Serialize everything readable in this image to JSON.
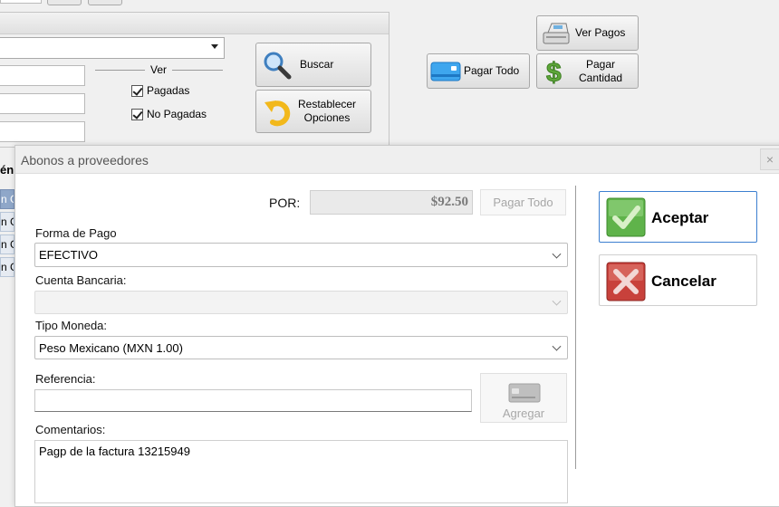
{
  "background": {
    "ver_group_label": "Ver",
    "chk_pagadas": "Pagadas",
    "chk_no_pagadas": "No Pagadas",
    "buscar": "Buscar",
    "restablecer_line1": "Restablecer",
    "restablecer_line2": "Opciones",
    "pagar_todo": "Pagar Todo",
    "ver_pagos": "Ver Pagos",
    "pagar_cantidad_line1": "Pagar",
    "pagar_cantidad_line2": "Cantidad",
    "grid_header_fragment": "én",
    "grid_rows": [
      "n Ge",
      "n Ge",
      "n Ge",
      "n Ge"
    ]
  },
  "dialog": {
    "title": "Abonos a proveedores",
    "close_glyph": "×",
    "por_label": "POR:",
    "por_value": "$92.50",
    "pagar_todo": "Pagar Todo",
    "forma_pago_label": "Forma de Pago",
    "forma_pago_value": "EFECTIVO",
    "cuenta_label": "Cuenta Bancaria:",
    "cuenta_value": "",
    "tipo_moneda_label": "Tipo Moneda:",
    "tipo_moneda_value": "Peso Mexicano (MXN 1.00)",
    "referencia_label": "Referencia:",
    "referencia_value": "",
    "agregar": "Agregar",
    "comentarios_label": "Comentarios:",
    "comentarios_value": "Pagp de la factura 13215949",
    "aceptar": "Aceptar",
    "cancelar": "Cancelar"
  },
  "colors": {
    "accent": "#3c7fd0",
    "ok_green": "#5fb34a",
    "cancel_red": "#c8413b"
  }
}
